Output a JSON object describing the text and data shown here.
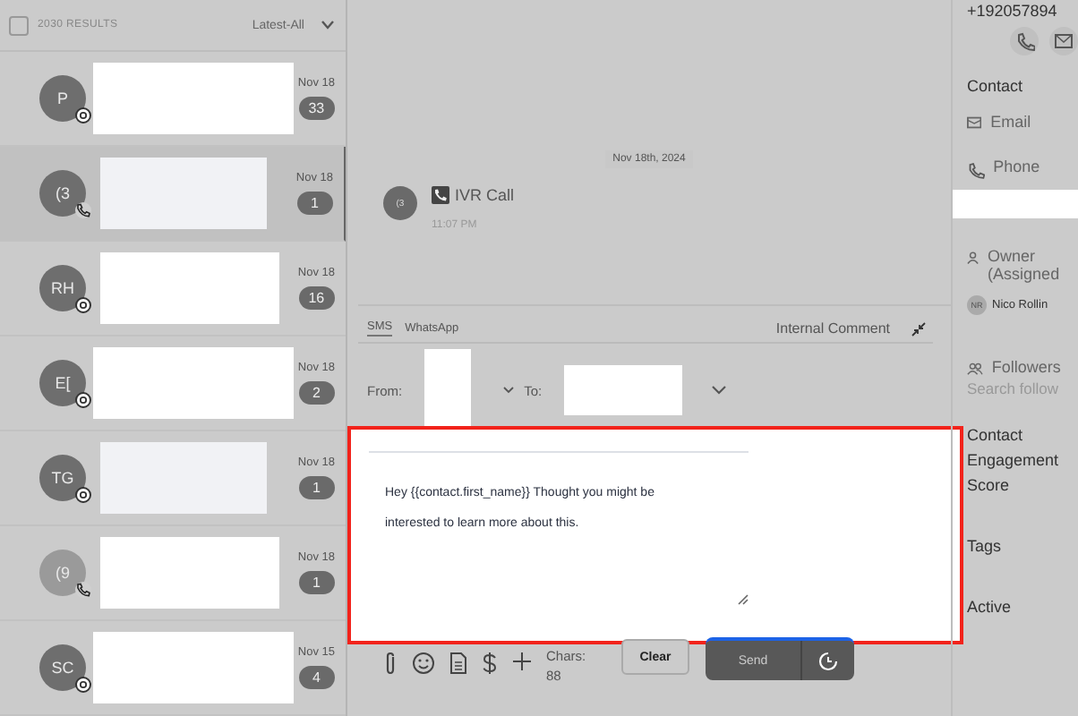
{
  "list_header": {
    "select_all_checked": false,
    "results": "2030 RESULTS",
    "sort": "Latest-All"
  },
  "conversations": [
    {
      "initials": "P",
      "kind": "chat",
      "date": "Nov 18",
      "unread": "33",
      "selected": false
    },
    {
      "initials": "(3",
      "kind": "call",
      "date": "Nov 18",
      "unread": "1",
      "selected": true
    },
    {
      "initials": "RH",
      "kind": "chat",
      "date": "Nov 18",
      "unread": "16",
      "selected": false
    },
    {
      "initials": "E[",
      "kind": "chat",
      "date": "Nov 18",
      "unread": "2",
      "selected": false
    },
    {
      "initials": "TG",
      "kind": "chat",
      "date": "Nov 18",
      "unread": "1",
      "selected": false
    },
    {
      "initials": "(9",
      "kind": "call",
      "date": "Nov 18",
      "unread": "1",
      "selected": false
    },
    {
      "initials": "SC",
      "kind": "chat",
      "date": "Nov 15",
      "unread": "4",
      "selected": false
    }
  ],
  "thread": {
    "date": "Nov 18th, 2024",
    "events": [
      {
        "avatar": "(3",
        "title": "IVR Call",
        "time": "11:07 PM"
      }
    ]
  },
  "composer": {
    "tabs": [
      {
        "label": "SMS",
        "selected": true
      },
      {
        "label": "WhatsApp",
        "selected": false
      }
    ],
    "internal_comment": "Internal Comment",
    "from_label": "From:",
    "to_label": "To:",
    "message": "Hey {{contact.first_name}} Thought you might be interested to learn more about this.",
    "chars": "Chars: 88",
    "clear": "Clear",
    "send": "Send"
  },
  "contact_panel": {
    "phone_number": "+192057894",
    "section_title": "Contact",
    "email_label": "Email",
    "phone_label": "Phone",
    "owner_label": "Owner (Assigned",
    "owner_initials": "NR",
    "owner_name": "Nico Rollin",
    "followers_label": "Followers",
    "followers_placeholder": "Search follow",
    "engagement_label": "Contact Engagement Score",
    "tags_label": "Tags",
    "active_label": "Active"
  }
}
